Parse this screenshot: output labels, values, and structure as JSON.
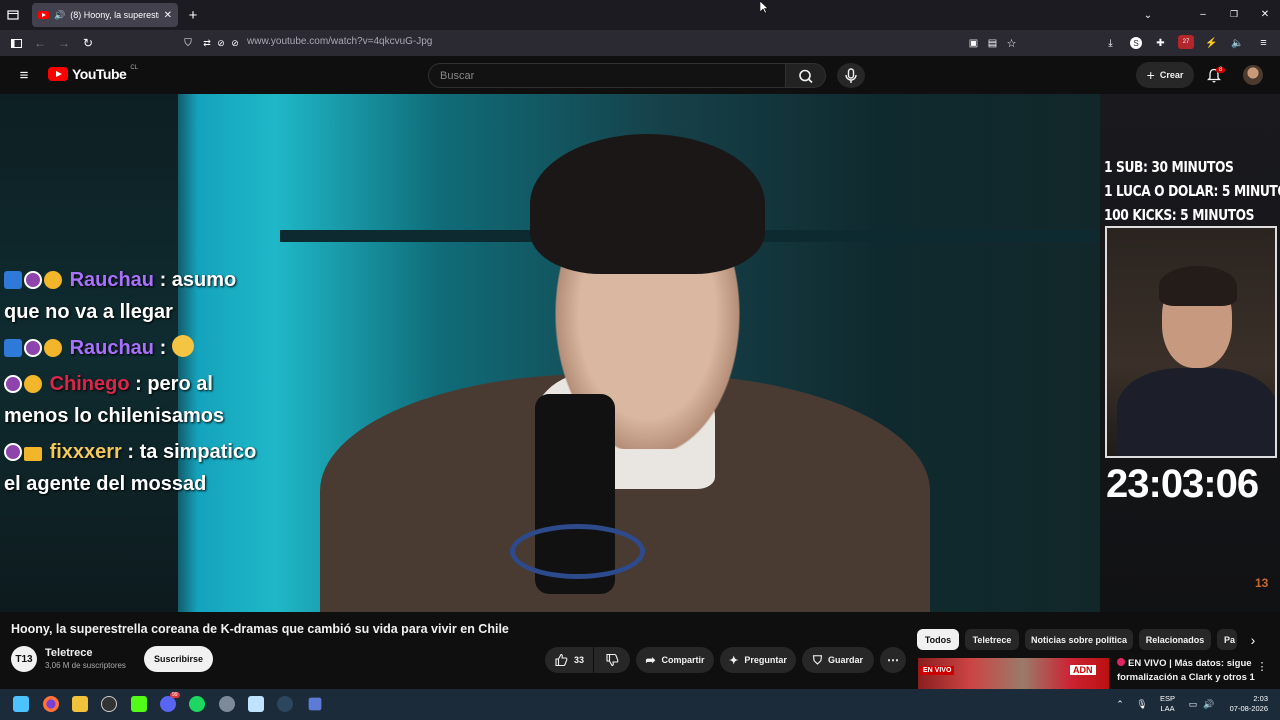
{
  "browser": {
    "tab_title": "(8) Hoony, la superestrella c",
    "url": "www.youtube.com/watch?v=4qkcvuG-Jpg",
    "extension_badge": "27"
  },
  "youtube": {
    "logo_text": "YouTube",
    "logo_country": "CL",
    "search_placeholder": "Buscar",
    "create_label": "Crear",
    "notifications_count": "8"
  },
  "stream_overlay": {
    "chat": [
      {
        "user": "Rauchau",
        "message": ": asumo",
        "message_cont": "que no va a llegar",
        "user_color": "#a970ff"
      },
      {
        "user": "Rauchau",
        "message": ":",
        "user_color": "#a970ff"
      },
      {
        "user": "Chinego",
        "message": ": pero al",
        "message_cont": "menos lo chilenisamos",
        "user_color": "#d9264a"
      },
      {
        "user": "fixxxerr",
        "message": ": ta simpatico",
        "message_cont": "el agente del mossad",
        "user_color": "#f2c95a"
      }
    ],
    "goals": [
      "1 SUB: 30 MINUTOS",
      "1 LUCA O DOLAR: 5 MINUTOS",
      "100 KICKS: 5 MINUTOS"
    ],
    "timer": "23:03:06",
    "corner_mark": "13"
  },
  "video": {
    "title": "Hoony, la superestrella coreana de K-dramas que cambió su vida para vivir en Chile",
    "channel_name": "Teletrece",
    "channel_logo_text": "T13",
    "subscribers": "3,06 M de suscriptores",
    "subscribe_label": "Suscribirse",
    "likes": "33",
    "share_label": "Compartir",
    "ask_label": "Preguntar",
    "save_label": "Guardar"
  },
  "recommendations": {
    "chips": [
      "Todos",
      "Teletrece",
      "Noticias sobre política",
      "Relacionados",
      "Pa"
    ],
    "first": {
      "live_tag": "EN VIVO",
      "channel_tag": "ADN",
      "title": "EN VIVO | Más datos: sigue formalización a Clark y otros 1"
    }
  },
  "taskbar": {
    "language": "ESP",
    "layout": "LAA",
    "time": "2:03",
    "date": "07-08-2026",
    "discord_badge": "99"
  }
}
